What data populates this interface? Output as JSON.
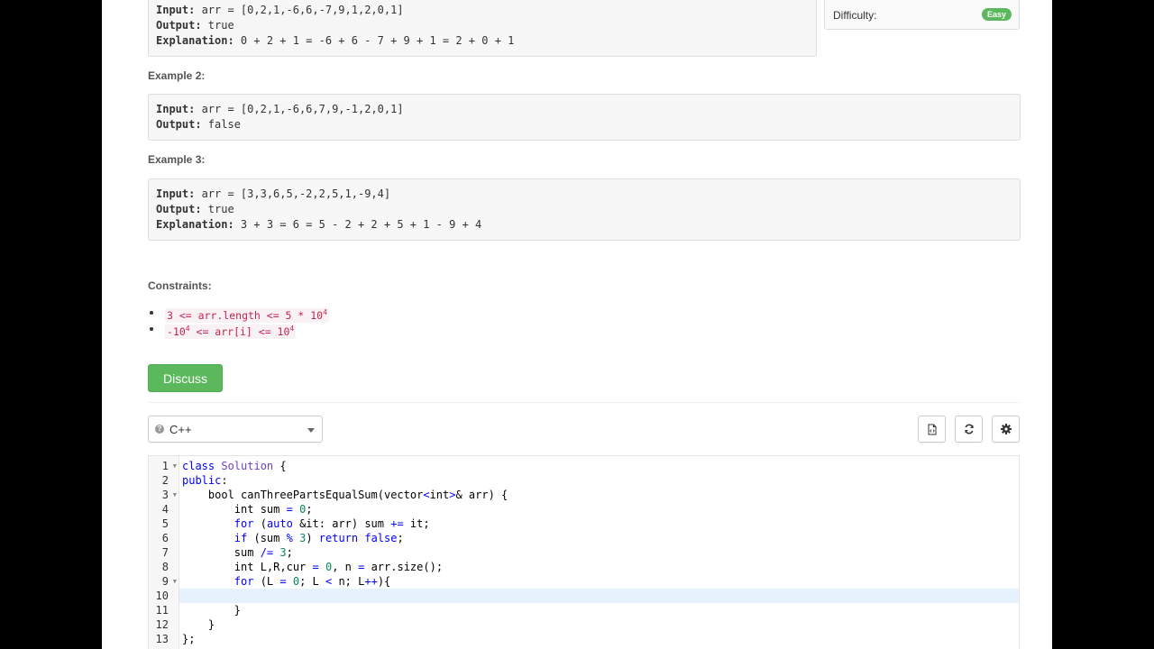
{
  "example1": {
    "input_label": "Input:",
    "input_value": " arr = [0,2,1,-6,6,-7,9,1,2,0,1]",
    "output_label": "Output:",
    "output_value": " true",
    "explanation_label": "Explanation:",
    "explanation_value": " 0 + 2 + 1 = -6 + 6 - 7 + 9 + 1 = 2 + 0 + 1"
  },
  "example2": {
    "heading": "Example 2:",
    "input_label": "Input:",
    "input_value": " arr = [0,2,1,-6,6,7,9,-1,2,0,1]",
    "output_label": "Output:",
    "output_value": " false"
  },
  "example3": {
    "heading": "Example 3:",
    "input_label": "Input:",
    "input_value": " arr = [3,3,6,5,-2,2,5,1,-9,4]",
    "output_label": "Output:",
    "output_value": " true",
    "explanation_label": "Explanation:",
    "explanation_value": " 3 + 3 = 6 = 5 - 2 + 2 + 5 + 1 - 9 + 4"
  },
  "sidebar": {
    "difficulty_label": "Difficulty:",
    "difficulty_value": "Easy"
  },
  "constraints": {
    "heading": "Constraints:",
    "c1_pre": "3 <= arr.length <= 5 * 10",
    "c1_sup": "4",
    "c2_a": "-10",
    "c2_sup1": "4",
    "c2_b": " <= arr[i] <= 10",
    "c2_sup2": "4"
  },
  "discuss_label": "Discuss",
  "editor": {
    "language": "C++",
    "line_numbers": [
      "1",
      "2",
      "3",
      "4",
      "5",
      "6",
      "7",
      "8",
      "9",
      "10",
      "11",
      "12",
      "13"
    ],
    "active_line": 10
  },
  "colors": {
    "accent_green": "#5cb85c",
    "keyword_blue": "#0000ff",
    "number_green": "#09885a"
  }
}
